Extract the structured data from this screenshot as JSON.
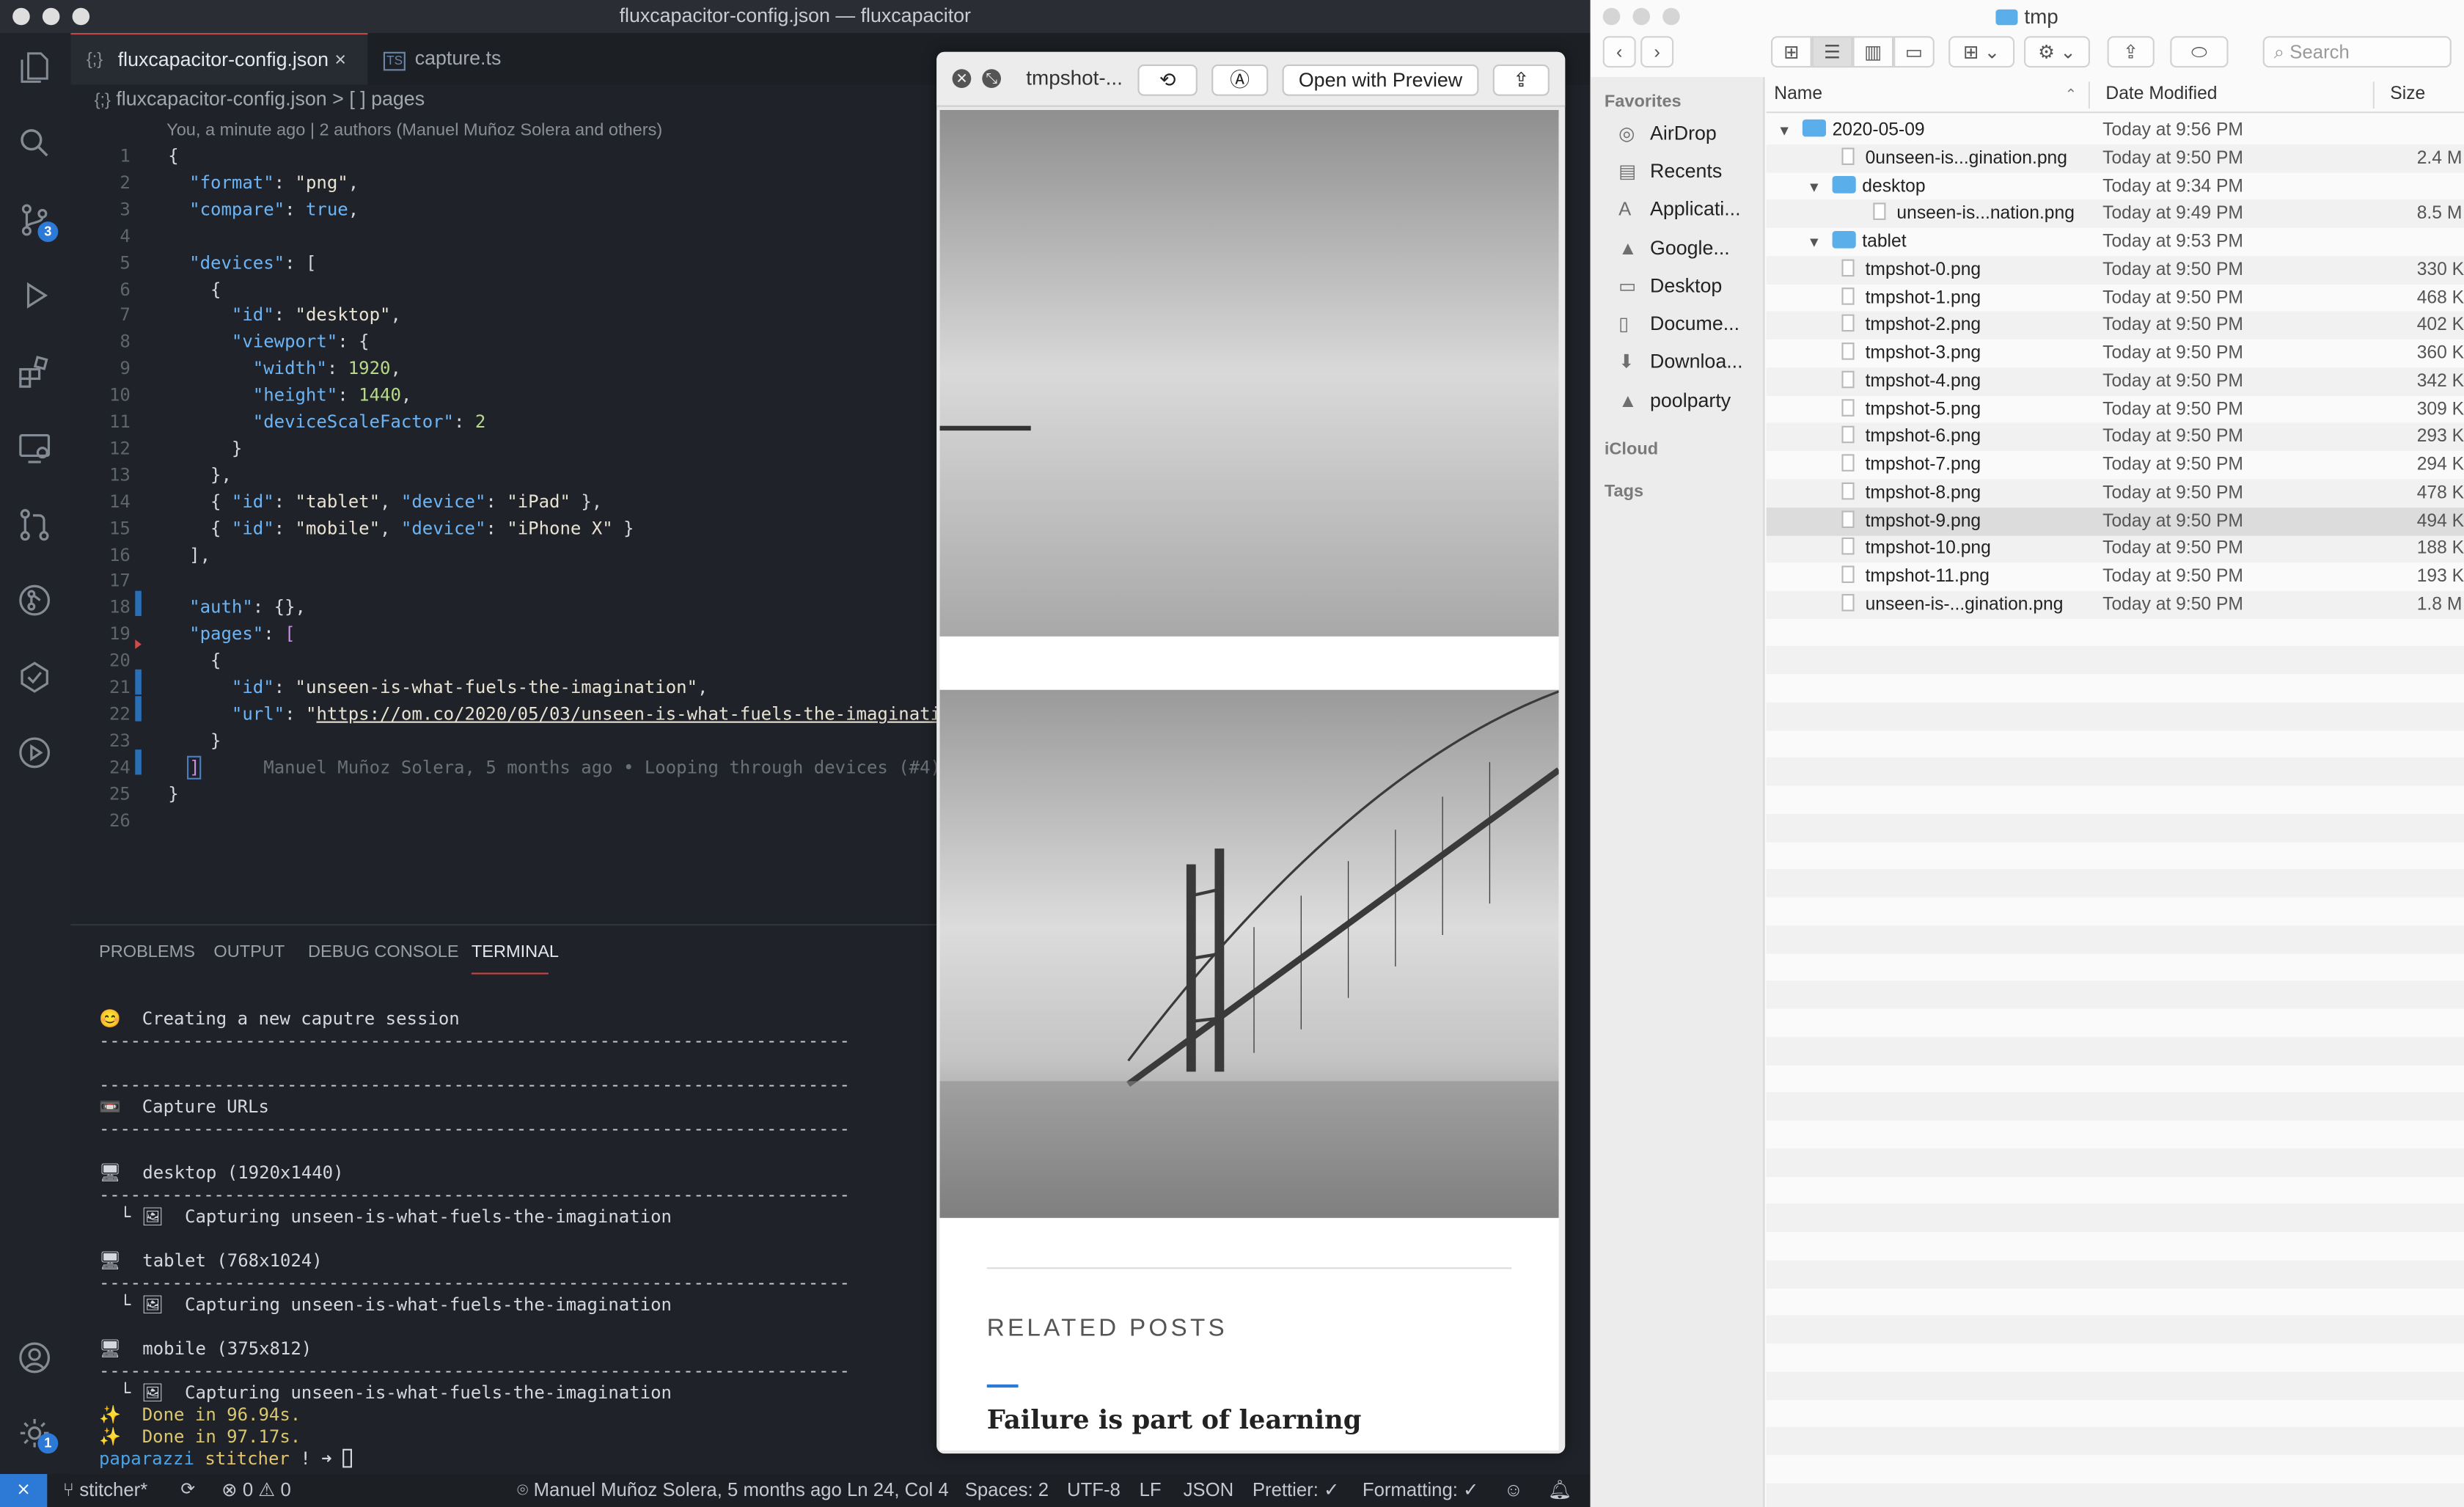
{
  "vscode": {
    "window_title": "fluxcapacitor-config.json — fluxcapacitor",
    "tabs": [
      {
        "icon": "{;}",
        "label": "fluxcapacitor-config.json",
        "close": "×"
      },
      {
        "icon": "TS",
        "label": "capture.ts"
      }
    ],
    "activity_badges": {
      "source_control": "3",
      "settings": "1"
    },
    "breadcrumb": {
      "file": "fluxcapacitor-config.json",
      "sep": ">",
      "node_icon": "[ ]",
      "node": "pages"
    },
    "blame_header": "You, a minute ago | 2 authors (Manuel Muñoz Solera and others)",
    "code_lines": [
      {
        "n": "1",
        "html": "{"
      },
      {
        "n": "2",
        "html": "  <span class=\"k\">\"format\"</span>: <span class=\"s\">\"png\"</span>,"
      },
      {
        "n": "3",
        "html": "  <span class=\"k\">\"compare\"</span>: <span class=\"k\">true</span>,"
      },
      {
        "n": "4",
        "html": ""
      },
      {
        "n": "5",
        "html": "  <span class=\"k\">\"devices\"</span>: ["
      },
      {
        "n": "6",
        "html": "    {"
      },
      {
        "n": "7",
        "html": "      <span class=\"k\">\"id\"</span>: <span class=\"s\">\"desktop\"</span>,"
      },
      {
        "n": "8",
        "html": "      <span class=\"k\">\"viewport\"</span>: {"
      },
      {
        "n": "9",
        "html": "        <span class=\"k\">\"width\"</span>: <span class=\"n\">1920</span>,"
      },
      {
        "n": "10",
        "html": "        <span class=\"k\">\"height\"</span>: <span class=\"n\">1440</span>,"
      },
      {
        "n": "11",
        "html": "        <span class=\"k\">\"deviceScaleFactor\"</span>: <span class=\"n\">2</span>"
      },
      {
        "n": "12",
        "html": "      }"
      },
      {
        "n": "13",
        "html": "    },"
      },
      {
        "n": "14",
        "html": "    { <span class=\"k\">\"id\"</span>: <span class=\"s\">\"tablet\"</span>, <span class=\"k\">\"device\"</span>: <span class=\"s\">\"iPad\"</span> },"
      },
      {
        "n": "15",
        "html": "    { <span class=\"k\">\"id\"</span>: <span class=\"s\">\"mobile\"</span>, <span class=\"k\">\"device\"</span>: <span class=\"s\">\"iPhone X\"</span> }"
      },
      {
        "n": "16",
        "html": "  ],"
      },
      {
        "n": "17",
        "html": ""
      },
      {
        "n": "18",
        "html": "  <span class=\"k\">\"auth\"</span>: {},"
      },
      {
        "n": "19",
        "html": "  <span class=\"k\">\"pages\"</span>: <span class=\"b\">[</span>"
      },
      {
        "n": "20",
        "html": "    {"
      },
      {
        "n": "21",
        "html": "      <span class=\"k\">\"id\"</span>: <span class=\"s\">\"unseen-is-what-fuels-the-imagination\"</span>,"
      },
      {
        "n": "22",
        "html": "      <span class=\"k\">\"url\"</span>: <span class=\"s\">\"<span class=\"u\">https://om.co/2020/05/03/unseen-is-what-fuels-the-imaginati</span></span>"
      },
      {
        "n": "23",
        "html": "    }"
      },
      {
        "n": "24",
        "html": "  <span class=\"b\" style=\"outline:1px solid #4a7ec0\">]</span>      <span style=\"color:#6a7079\">Manuel Muñoz Solera, 5 months ago • Looping through devices (#4)</span>"
      },
      {
        "n": "25",
        "html": "}"
      },
      {
        "n": "26",
        "html": ""
      }
    ],
    "panel_tabs": [
      "PROBLEMS",
      "OUTPUT",
      "DEBUG CONSOLE",
      "TERMINAL"
    ],
    "terminal": {
      "creating": "😊  Creating a new caputre session",
      "capture_urls": "📼  Capture URLs",
      "desktop": "🖥  desktop (1920x1440)",
      "tablet": "🖥  tablet (768x1024)",
      "mobile": "🖥  mobile (375x812)",
      "capturing": "  └ 🖼  Capturing unseen-is-what-fuels-the-imagination",
      "done1": "✨  Done in 96.94s.",
      "done2": "✨  Done in 97.17s.",
      "prompt_dir": "paparazzi",
      "prompt_branch": "stitcher",
      "prompt_tail": "! ➜ "
    },
    "status": {
      "branch": "stitcher*",
      "problems": "⊗ 0 ⚠ 0",
      "blame": "Manuel Muñoz Solera, 5 months ago",
      "position": "Ln 24, Col 4",
      "spaces": "Spaces: 2",
      "encoding": "UTF-8",
      "eol": "LF",
      "language": "JSON",
      "prettier": "Prettier: ✓",
      "formatting": "Formatting: ✓"
    }
  },
  "quicklook": {
    "title": "tmpshot-...",
    "open_with": "Open with Preview",
    "related_heading": "RELATED POSTS",
    "related_post": "Failure is part of learning"
  },
  "finder": {
    "title": "tmp",
    "search_placeholder": "Search",
    "sidebar": {
      "favorites_header": "Favorites",
      "favorites": [
        "AirDrop",
        "Recents",
        "Applicati...",
        "Google...",
        "Desktop",
        "Docume...",
        "Downloa...",
        "poolparty"
      ],
      "icloud_header": "iCloud",
      "tags_header": "Tags"
    },
    "columns": {
      "name": "Name",
      "date": "Date Modified",
      "size": "Size"
    },
    "rows": [
      {
        "name": "2020-05-09",
        "date": "Today at 9:56 PM",
        "size": "",
        "kind": "folder",
        "level": 0,
        "open": true
      },
      {
        "name": "0unseen-is...gination.png",
        "date": "Today at 9:50 PM",
        "size": "2.4 M",
        "kind": "file",
        "level": 1
      },
      {
        "name": "desktop",
        "date": "Today at 9:34 PM",
        "size": "",
        "kind": "folder",
        "level": 1,
        "open": true
      },
      {
        "name": "unseen-is...nation.png",
        "date": "Today at 9:49 PM",
        "size": "8.5 M",
        "kind": "file",
        "level": 2
      },
      {
        "name": "tablet",
        "date": "Today at 9:53 PM",
        "size": "",
        "kind": "folder",
        "level": 1,
        "open": true
      },
      {
        "name": "tmpshot-0.png",
        "date": "Today at 9:50 PM",
        "size": "330 K",
        "kind": "file",
        "level": 1
      },
      {
        "name": "tmpshot-1.png",
        "date": "Today at 9:50 PM",
        "size": "468 K",
        "kind": "file",
        "level": 1
      },
      {
        "name": "tmpshot-2.png",
        "date": "Today at 9:50 PM",
        "size": "402 K",
        "kind": "file",
        "level": 1
      },
      {
        "name": "tmpshot-3.png",
        "date": "Today at 9:50 PM",
        "size": "360 K",
        "kind": "file",
        "level": 1
      },
      {
        "name": "tmpshot-4.png",
        "date": "Today at 9:50 PM",
        "size": "342 K",
        "kind": "file",
        "level": 1
      },
      {
        "name": "tmpshot-5.png",
        "date": "Today at 9:50 PM",
        "size": "309 K",
        "kind": "file",
        "level": 1
      },
      {
        "name": "tmpshot-6.png",
        "date": "Today at 9:50 PM",
        "size": "293 K",
        "kind": "file",
        "level": 1
      },
      {
        "name": "tmpshot-7.png",
        "date": "Today at 9:50 PM",
        "size": "294 K",
        "kind": "file",
        "level": 1
      },
      {
        "name": "tmpshot-8.png",
        "date": "Today at 9:50 PM",
        "size": "478 K",
        "kind": "file",
        "level": 1
      },
      {
        "name": "tmpshot-9.png",
        "date": "Today at 9:50 PM",
        "size": "494 K",
        "kind": "file",
        "level": 1,
        "selected": true
      },
      {
        "name": "tmpshot-10.png",
        "date": "Today at 9:50 PM",
        "size": "188 K",
        "kind": "file",
        "level": 1
      },
      {
        "name": "tmpshot-11.png",
        "date": "Today at 9:50 PM",
        "size": "193 K",
        "kind": "file",
        "level": 1
      },
      {
        "name": "unseen-is-...gination.png",
        "date": "Today at 9:50 PM",
        "size": "1.8 M",
        "kind": "file",
        "level": 1
      }
    ]
  },
  "colors": {
    "accent": "#2c7ad6",
    "tab_active_border": "#c64545",
    "terminal_prompt": "#4aa3e8",
    "branch": "#e3c46a"
  }
}
